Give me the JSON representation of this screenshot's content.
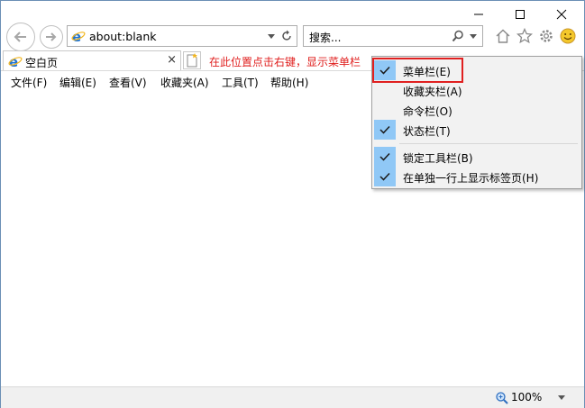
{
  "address": {
    "url": "about:blank"
  },
  "search": {
    "placeholder": "搜索..."
  },
  "tab": {
    "title": "空白页",
    "close": "×"
  },
  "hint": "在此位置点击右键，显示菜单栏",
  "menubar": {
    "items": [
      "文件(F)",
      "编辑(E)",
      "查看(V)",
      "收藏夹(A)",
      "工具(T)",
      "帮助(H)"
    ]
  },
  "context_menu": {
    "items": [
      {
        "label": "菜单栏(E)",
        "checked": true
      },
      {
        "label": "收藏夹栏(A)",
        "checked": false
      },
      {
        "label": "命令栏(O)",
        "checked": false
      },
      {
        "label": "状态栏(T)",
        "checked": true
      },
      {
        "label": "锁定工具栏(B)",
        "checked": true
      },
      {
        "label": "在单独一行上显示标签页(H)",
        "checked": true
      }
    ]
  },
  "status": {
    "zoom": "100%"
  },
  "colors": {
    "hint": "#e0201f",
    "check_bg": "#90c8f6",
    "highlight": "#e02020",
    "ie_blue": "#1e73d2"
  }
}
